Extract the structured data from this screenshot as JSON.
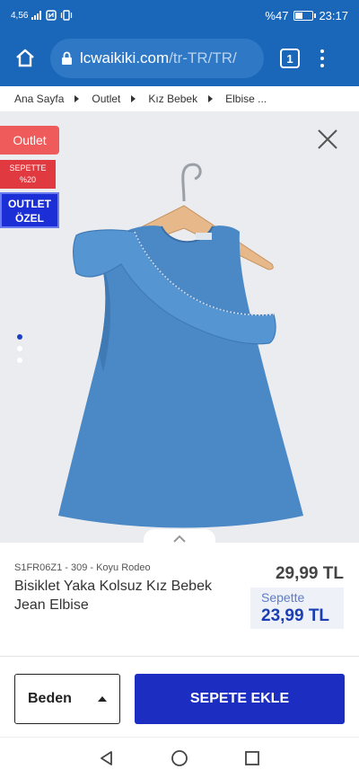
{
  "status_bar": {
    "network": "4,56 ",
    "battery_text": "%47",
    "battery_level": 0.47,
    "time": "23:17"
  },
  "browser": {
    "url_host": "lcwaikiki.com",
    "url_path": "/tr-TR/TR/",
    "tab_count": "1"
  },
  "breadcrumb": [
    "Ana Sayfa",
    "Outlet",
    "Kız Bebek",
    "Elbise ..."
  ],
  "badges": {
    "outlet": "Outlet",
    "sepete_line1": "SEPETTE",
    "sepete_line2": "%20",
    "ozel_line1": "OUTLET",
    "ozel_line2": "ÖZEL"
  },
  "gallery": {
    "image_count": 3,
    "active_index": 0
  },
  "product": {
    "sku": "S1FR06Z1 - 309 - Koyu Rodeo",
    "title": "Bisiklet Yaka Kolsuz Kız Bebek Jean Elbise",
    "price": "29,99 TL",
    "sepete_label": "Sepette",
    "sepete_price": "23,99 TL"
  },
  "actions": {
    "size_label": "Beden",
    "add_to_cart": "SEPETE EKLE"
  },
  "colors": {
    "brand_blue": "#1a66b8",
    "cta_blue": "#1c2ec2",
    "outlet_red": "#ef5a5a"
  }
}
